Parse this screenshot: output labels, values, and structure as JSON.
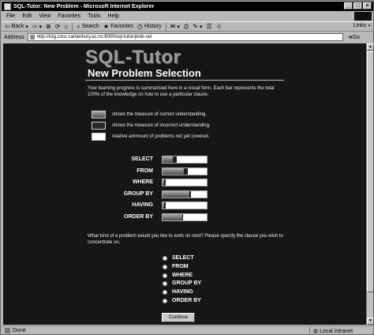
{
  "window": {
    "title": "SQL-Tutor: New Problem - Microsoft Internet Explorer",
    "controls": [
      "_",
      "□",
      "×"
    ]
  },
  "menu": [
    "File",
    "Edit",
    "View",
    "Favorites",
    "Tools",
    "Help"
  ],
  "toolbar": {
    "back": "Back",
    "search": "Search",
    "favorites": "Favorites",
    "history": "History",
    "links": "Links"
  },
  "address": {
    "label": "Address",
    "url": "http://ictg.cosc.canterbury.ac.nz:8000/sql-tutor/prob-sel",
    "go": "Go"
  },
  "status": {
    "text": "Done",
    "zone": "Local intranet"
  },
  "page": {
    "logo": "SQL-Tutor",
    "subtitle": "New Problem Selection",
    "intro": "Your learning progress is summarised here in a visual form. Each bar represents the total 100% of the knowledge on how to use a particular clause.",
    "legend": [
      {
        "kind": "correct",
        "text": "shows the measure of correct understanding."
      },
      {
        "kind": "incorrect",
        "text": "shows the measure of incorrect understanding."
      },
      {
        "kind": "notcovered",
        "text": "relative ammount of problems not yet covered."
      }
    ],
    "progress": [
      {
        "clause": "SELECT",
        "correct": 0.24,
        "incorrect": 0.08,
        "notcovered": 0.68
      },
      {
        "clause": "FROM",
        "correct": 0.48,
        "incorrect": 0.1,
        "notcovered": 0.42
      },
      {
        "clause": "WHERE",
        "correct": 0.03,
        "incorrect": 0.04,
        "notcovered": 0.93
      },
      {
        "clause": "GROUP BY",
        "correct": 0.6,
        "incorrect": 0.05,
        "notcovered": 0.35
      },
      {
        "clause": "HAVING",
        "correct": 0.03,
        "incorrect": 0.05,
        "notcovered": 0.92
      },
      {
        "clause": "ORDER BY",
        "correct": 0.44,
        "incorrect": 0.02,
        "notcovered": 0.54
      }
    ],
    "question": "What kind of a problem would you like to work on next? Please specify the clause you wish to concentrate on.",
    "options": [
      "SELECT",
      "FROM",
      "WHERE",
      "GROUP BY",
      "HAVING",
      "ORDER BY"
    ],
    "continue": "Continue"
  }
}
